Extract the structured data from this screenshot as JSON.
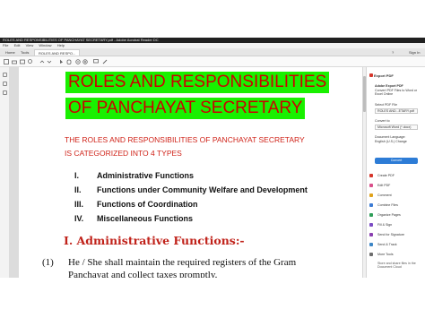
{
  "window": {
    "title": "ROLES AND RESPONSIBILITIES OF PANCHAYAT SECRETARY.pdf - Adobe Acrobat Reader DC"
  },
  "menubar": {
    "items": [
      "File",
      "Edit",
      "View",
      "Window",
      "Help"
    ]
  },
  "tabs": {
    "home": "Home",
    "tools": "Tools",
    "document": "ROLES AND RESPO...",
    "help": "?",
    "signin": "Sign In"
  },
  "toolbar": {
    "icons": [
      "save-icon",
      "print-icon",
      "email-icon",
      "search-icon",
      "prev-page-icon",
      "next-page-icon",
      "select-cursor-icon",
      "hand-tool-icon",
      "zoom-out-icon",
      "zoom-in-icon",
      "comment-icon",
      "pen-icon"
    ]
  },
  "document": {
    "heading_line1": "ROLES AND RESPONSIBILITIES",
    "heading_line2": "OF PANCHAYAT SECRETARY",
    "subheading_line1": "THE ROLES AND RESPONSIBILITIES OF PANCHAYAT SECRETARY",
    "subheading_line2": "IS CATEGORIZED INTO 4 TYPES",
    "types": [
      {
        "numeral": "I.",
        "text": "Administrative Functions"
      },
      {
        "numeral": "II.",
        "text": "Functions under Community Welfare and Development"
      },
      {
        "numeral": "III.",
        "text": "Functions of Coordination"
      },
      {
        "numeral": "IV.",
        "text": "Miscellaneous Functions"
      }
    ],
    "section1_title": "I. Administrative Functions:-",
    "para_number": "(1)",
    "para_line1": "He / She shall maintain the required registers of the Gram",
    "para_line2": "Panchayat and collect taxes promptly."
  },
  "right_panel": {
    "export_title": "Export PDF",
    "service_title": "Adobe Export PDF",
    "service_desc": "Convert PDF Files to Word or Excel Online",
    "select_label": "Select PDF File",
    "file_value": "ROLES AND...ETARY.pdf",
    "convert_to_label": "Convert to",
    "format_value": "Microsoft Word (*.docx)",
    "language_label": "Document Language:",
    "language_value": "English (U.S.) Change",
    "convert_button": "Convert",
    "tools": [
      {
        "label": "Create PDF",
        "color": "#d6362b"
      },
      {
        "label": "Edit PDF",
        "color": "#d94f8a"
      },
      {
        "label": "Comment",
        "color": "#e0a21b"
      },
      {
        "label": "Combine Files",
        "color": "#3c7bd4"
      },
      {
        "label": "Organize Pages",
        "color": "#2e9e58"
      },
      {
        "label": "Fill & Sign",
        "color": "#7b4cc4"
      },
      {
        "label": "Send for Signature",
        "color": "#8a3fb0"
      },
      {
        "label": "Send & Track",
        "color": "#3d86c6"
      },
      {
        "label": "More Tools",
        "color": "#6d6d6d"
      }
    ],
    "footer": "Store and share files in the Document Cloud"
  }
}
